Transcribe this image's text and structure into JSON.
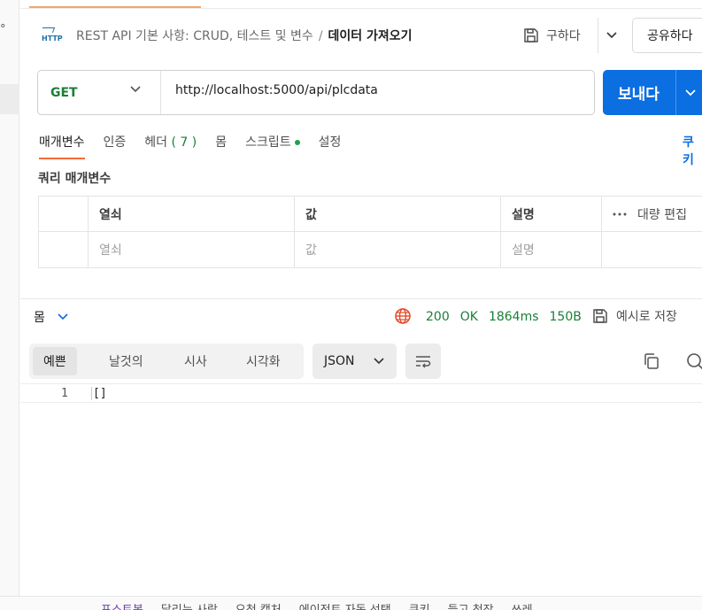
{
  "left_sidebar": {
    "fragment": "°"
  },
  "header": {
    "method_icon_text": "HTTP",
    "breadcrumb_parent": "REST API 기본 사항: CRUD, 테스트 및 변수",
    "breadcrumb_separator": "/",
    "breadcrumb_current": "데이터 가져오기",
    "save_label": "구하다",
    "share_label": "공유하다"
  },
  "request": {
    "method": "GET",
    "url": "http://localhost:5000/api/plcdata",
    "send_label": "보내다"
  },
  "request_tabs": [
    {
      "label": "매개변수",
      "active": true
    },
    {
      "label": "인증"
    },
    {
      "label": "헤더",
      "count": "( 7 )"
    },
    {
      "label": "몸"
    },
    {
      "label": "스크립트",
      "indicator": true
    },
    {
      "label": "설정"
    }
  ],
  "cookies_label": "쿠키",
  "query_params": {
    "title": "쿼리 매개변수",
    "headers": [
      "열쇠",
      "값",
      "설명"
    ],
    "bulk_edit_label": "대량 편집",
    "placeholder_row": [
      "열쇠",
      "값",
      "설명"
    ]
  },
  "response": {
    "section_label": "몸",
    "status_code": "200",
    "status_text": "OK",
    "time": "1864ms",
    "size": "150B",
    "save_example_label": "예시로 저장",
    "view_tabs": [
      "예쁜",
      "날것의",
      "시사",
      "시각화"
    ],
    "active_view": "예쁜",
    "format": "JSON",
    "lines": [
      {
        "number": "1",
        "text": "[]"
      }
    ]
  },
  "status_bar": {
    "items": [
      "포스트봇",
      "달리는 사람",
      "요청 캡처",
      "에이전트 자동 선택",
      "쿠키",
      "들고 청장",
      "쓰레"
    ]
  },
  "colors": {
    "accent_blue": "#0b6ee1",
    "method_green": "#1a7f37",
    "active_tab_underline": "#f26b3a"
  }
}
